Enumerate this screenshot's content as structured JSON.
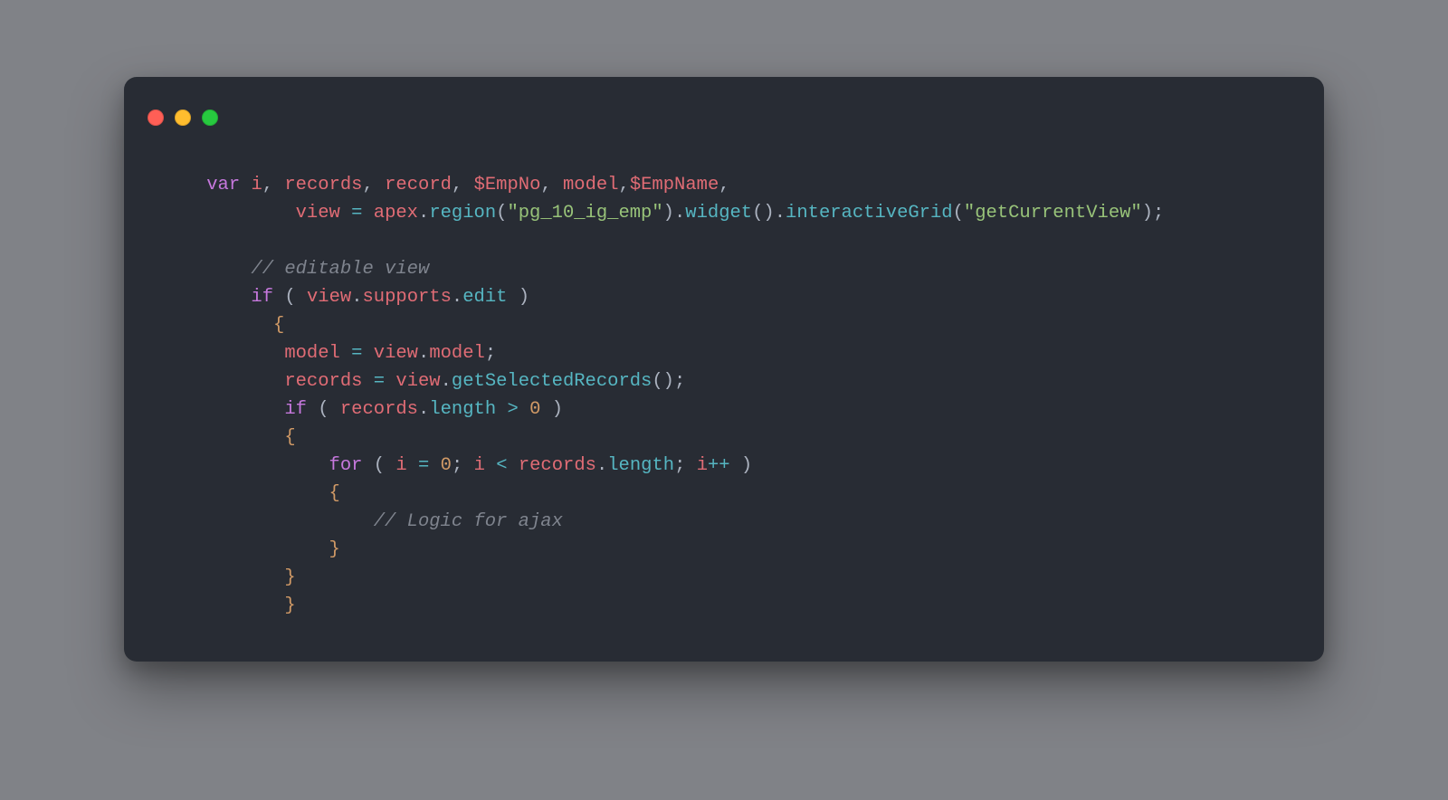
{
  "traffic": {
    "close": "close",
    "minimize": "minimize",
    "maximize": "maximize"
  },
  "code": {
    "tokens": {
      "var": "var",
      "i": "i",
      "records": "records",
      "record": "record",
      "empNo": "$EmpNo",
      "model": "model",
      "empName": "$EmpName",
      "view": "view",
      "eq": "=",
      "apex": "apex",
      "dot": ".",
      "region": "region",
      "lparen": "(",
      "rparen": ")",
      "semi": ";",
      "comma": ",",
      "s_region": "\"pg_10_ig_emp\"",
      "widget": "widget",
      "interactiveGrid": "interactiveGrid",
      "s_getCurrentView": "\"getCurrentView\"",
      "c_editable": "// editable view",
      "if": "if",
      "supports": "supports",
      "edit": "edit",
      "lbrace": "{",
      "rbrace": "}",
      "getSelectedRecords": "getSelectedRecords",
      "length": "length",
      "gt": ">",
      "zero": "0",
      "for": "for",
      "lt": "<",
      "pp": "++",
      "c_logic": "// Logic for ajax"
    }
  }
}
